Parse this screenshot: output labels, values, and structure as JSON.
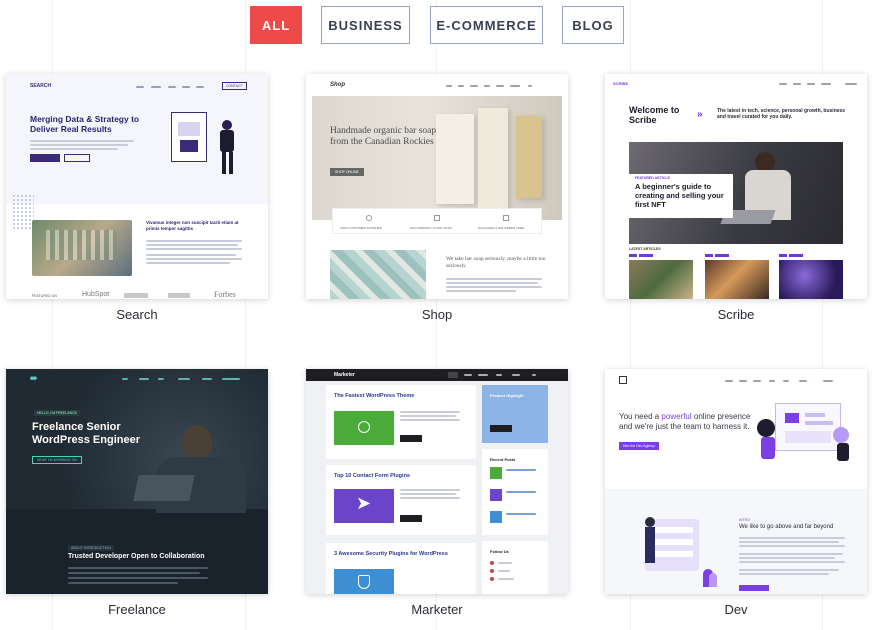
{
  "filters": [
    {
      "label": "ALL",
      "active": true
    },
    {
      "label": "BUSINESS",
      "active": false
    },
    {
      "label": "E-COMMERCE",
      "active": false
    },
    {
      "label": "BLOG",
      "active": false
    }
  ],
  "cards": {
    "search": {
      "caption": "Search",
      "logo": "SEARCH",
      "nav_button": "CONTACT",
      "headline": "Merging Data & Strategy to Deliver Real Results",
      "section_title": "Vivamus integer non suscipit taciti etiam at primis tempor sagittis",
      "featured_label": "FEATURED ON",
      "logos": [
        "HubSpot",
        "Forbes"
      ]
    },
    "shop": {
      "caption": "Shop",
      "logo": "Shop",
      "hero_title": "Handmade organic bar soap from the Canadian Rockies",
      "hero_button": "SHOP ONLINE",
      "feature_1": "100% CUSTOMER SATISFIED",
      "feature_2": "ECO FRIENDLY & NON-TOXIC",
      "feature_3": "PACKAGED & DELIVERED FREE",
      "subhead": "We take bar soap seriously, maybe a little too seriously"
    },
    "scribe": {
      "caption": "Scribe",
      "logo": "SCRIBE",
      "welcome": "Welcome to Scribe",
      "tagline": "The latest in tech, science, personal growth, business and travel curated for you daily.",
      "featured_label": "FEATURED ARTICLE",
      "featured_title": "A beginner's guide to creating and selling your first NFT",
      "latest_label": "LATEST ARTICLES"
    },
    "freelance": {
      "caption": "Freelance",
      "tag": "HELLO, I'M FREELANCE",
      "headline": "Freelance Senior WordPress Engineer",
      "button": "WHAT I'M WORKING ON",
      "section_tag": "ABOUT INTRODUCTION",
      "section_title": "Trusted Developer Open to Collaboration"
    },
    "marketer": {
      "caption": "Marketer",
      "logo": "Marketer",
      "post_1": "The Fastest WordPress Theme",
      "post_2": "Top 10 Contact Form Plugins",
      "post_3": "3 Awesome Security Plugins for WordPress",
      "sidebar_title": "Product Highlight",
      "recent_posts": "Recent Posts",
      "follow": "Follow Us"
    },
    "dev": {
      "caption": "Dev",
      "headline_pre": "You need a ",
      "headline_accent": "powerful",
      "headline_post": " online presence and we're just the team to harness it.",
      "button": "Hire the Dev Agency",
      "section_tag": "INTRO",
      "section_title": "We like to go above and far beyond"
    }
  },
  "colors": {
    "accent": "#ef4a4a",
    "search_purple": "#3b2a7a",
    "scribe_purple": "#6c3bd9",
    "freelance_dark": "#1f2a33",
    "marketer_blue": "#3d6fd1",
    "marketer_green": "#4aab38",
    "marketer_violet": "#6a44c9",
    "dev_purple": "#7b3fe4"
  }
}
